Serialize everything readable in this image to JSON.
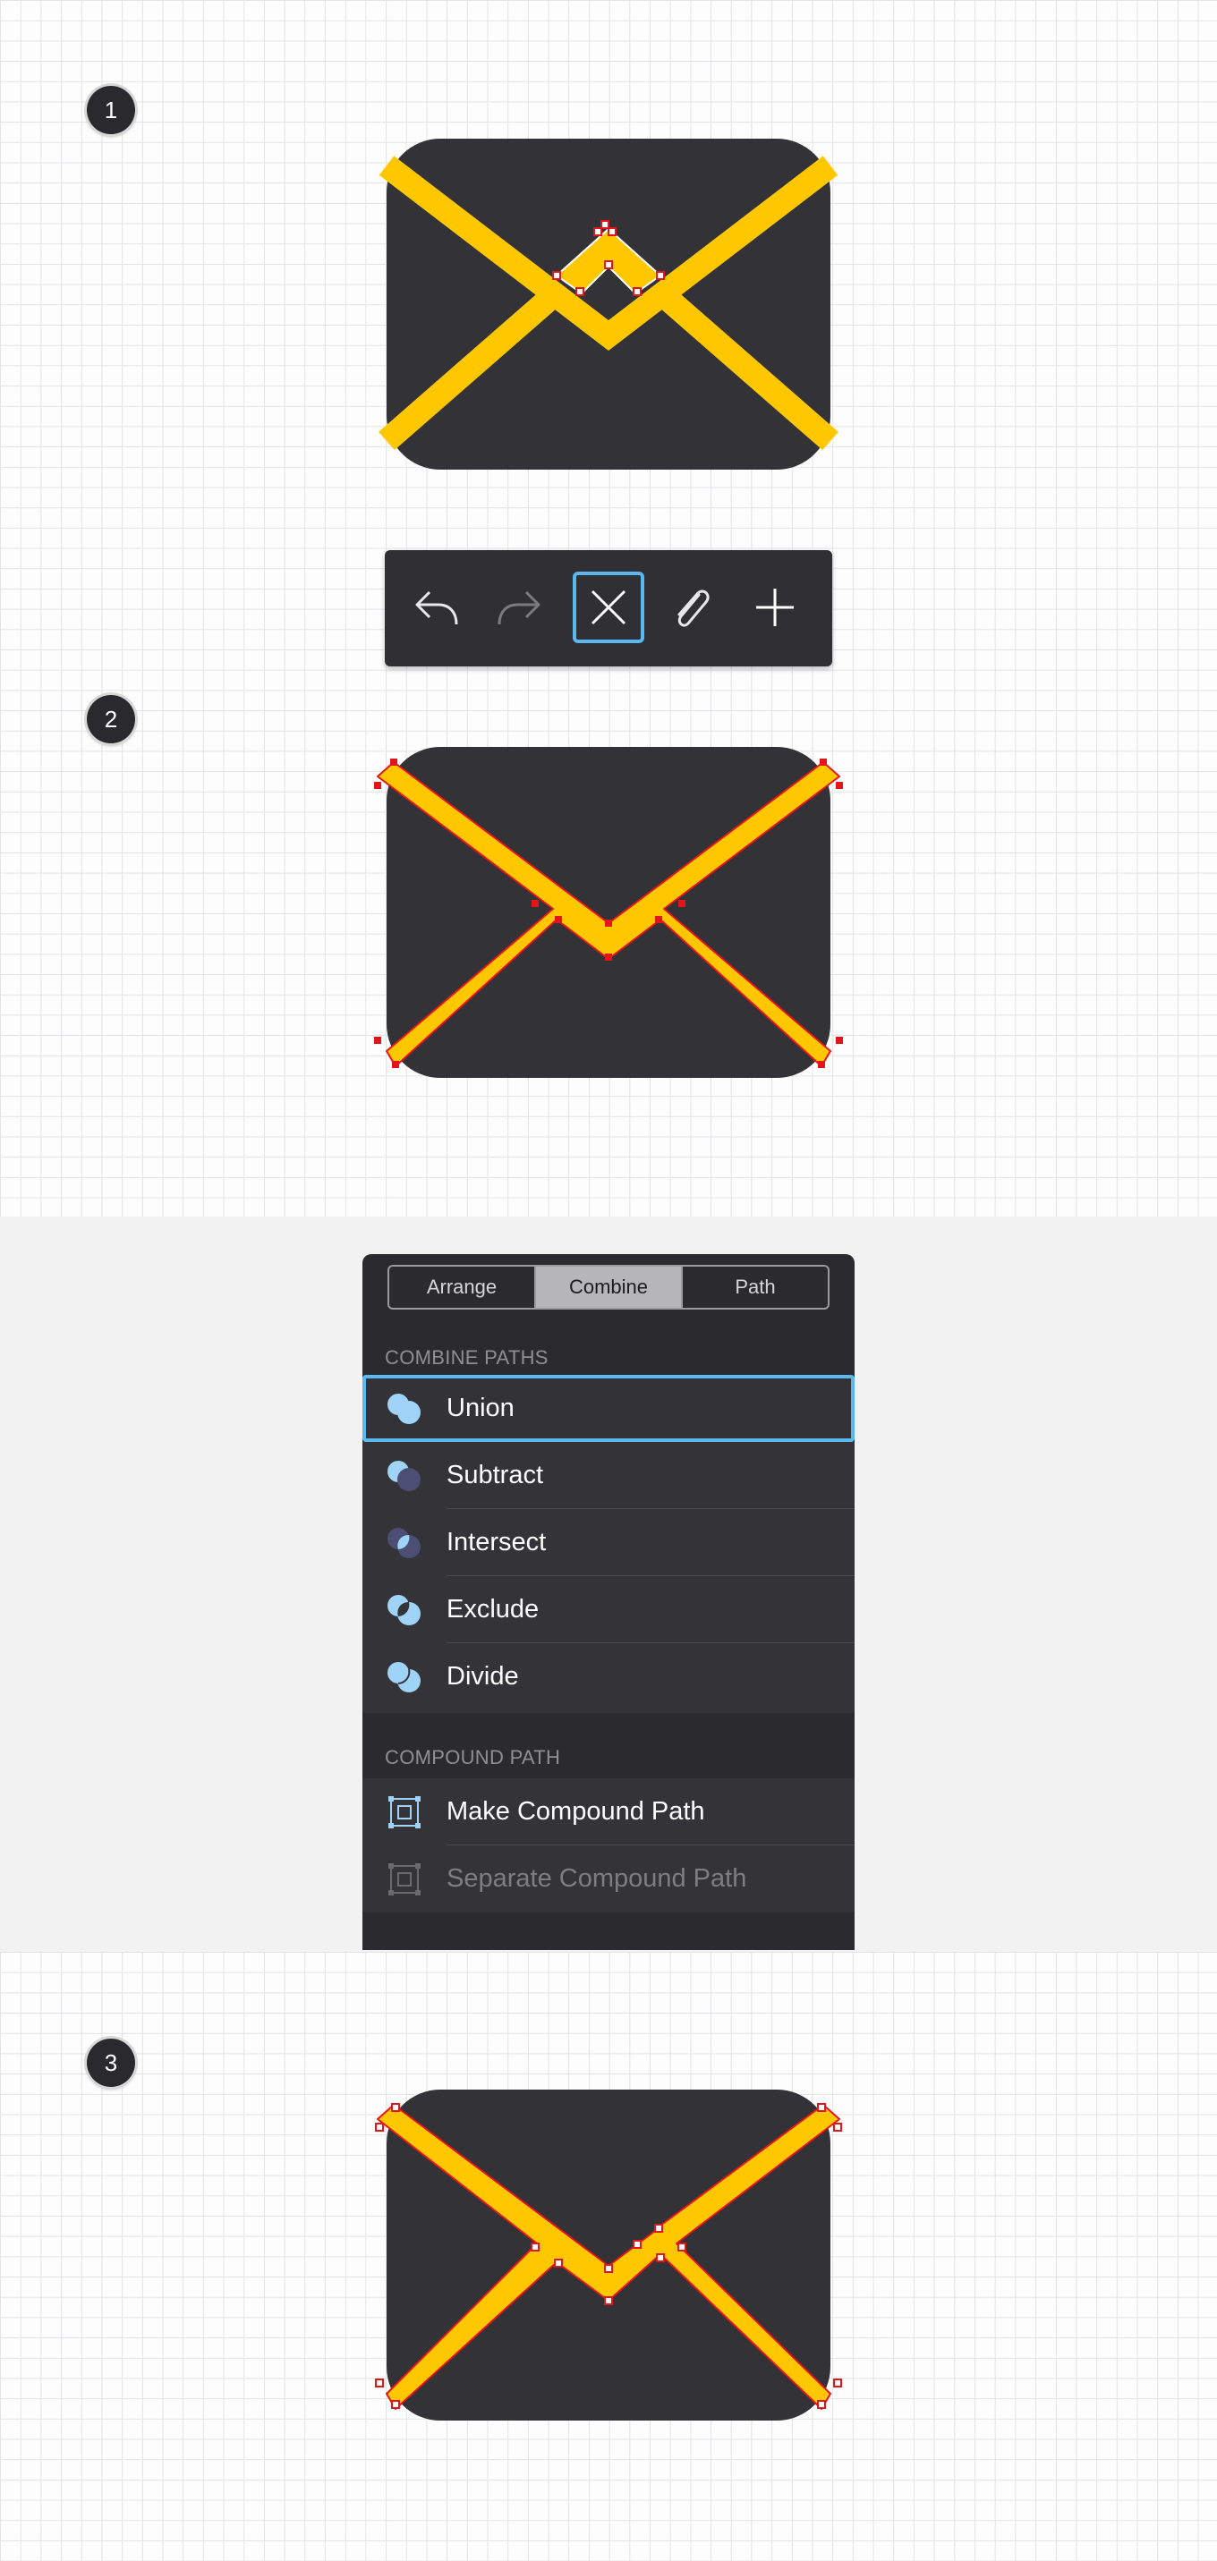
{
  "steps": {
    "step1": "1",
    "step2": "2",
    "step3": "3"
  },
  "colors": {
    "envelope_body": "#323237",
    "envelope_stroke": "#ffc700",
    "selection_path": "#e3151b",
    "accent": "#5ab8f0",
    "canvas_grid": "#e3e3e6"
  },
  "toolbar": {
    "buttons": [
      {
        "icon": "undo-icon",
        "enabled": true,
        "active": false
      },
      {
        "icon": "redo-icon",
        "enabled": false,
        "active": false
      },
      {
        "icon": "close-icon",
        "enabled": true,
        "active": true
      },
      {
        "icon": "paperclip-icon",
        "enabled": true,
        "active": false
      },
      {
        "icon": "plus-icon",
        "enabled": true,
        "active": false
      }
    ]
  },
  "panel": {
    "tabs": [
      "Arrange",
      "Combine",
      "Path"
    ],
    "selected_tab": "Combine",
    "combine_paths_header": "COMBINE PATHS",
    "combine_items": [
      {
        "label": "Union",
        "icon": "union-icon",
        "highlighted": true
      },
      {
        "label": "Subtract",
        "icon": "subtract-icon",
        "highlighted": false
      },
      {
        "label": "Intersect",
        "icon": "intersect-icon",
        "highlighted": false
      },
      {
        "label": "Exclude",
        "icon": "exclude-icon",
        "highlighted": false
      },
      {
        "label": "Divide",
        "icon": "divide-icon",
        "highlighted": false
      }
    ],
    "compound_path_header": "COMPOUND PATH",
    "compound_items": [
      {
        "label": "Make Compound Path",
        "icon": "make-compound-path-icon",
        "enabled": true
      },
      {
        "label": "Separate Compound Path",
        "icon": "separate-compound-path-icon",
        "enabled": false
      }
    ]
  }
}
